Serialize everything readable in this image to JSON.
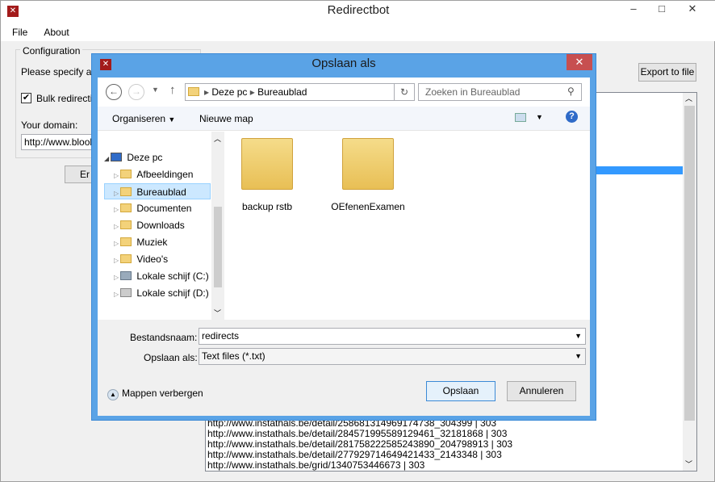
{
  "main": {
    "title": "Redirectbot",
    "menu": [
      "File",
      "About"
    ],
    "group_label": "Configuration",
    "instruction": "Please specify a C",
    "bulk_label": "Bulk redirection",
    "bulk_checked": true,
    "domain_label": "Your domain:",
    "domain_value": "http://www.bloob",
    "action_button": "Er",
    "export_button": "Export to file",
    "output_lines": [
      "http://www.instathals.be/detail/258681314969174738_304399 | 303",
      "http://www.instathals.be/detail/284571995589129461_32181868 | 303",
      "http://www.instathals.be/detail/281758222585243890_204798913 | 303",
      "http://www.instathals.be/detail/277929714649421433_2143348 | 303",
      "http://www.instathals.be/grid/1340753446673 | 303"
    ]
  },
  "dialog": {
    "title": "Opslaan als",
    "breadcrumb": [
      "Deze pc",
      "Bureaublad"
    ],
    "search_placeholder": "Zoeken in Bureaublad",
    "organize": "Organiseren",
    "new_folder": "Nieuwe map",
    "tree": [
      {
        "label": "Deze pc",
        "root": true
      },
      {
        "label": "Afbeeldingen"
      },
      {
        "label": "Bureaublad",
        "selected": true
      },
      {
        "label": "Documenten"
      },
      {
        "label": "Downloads"
      },
      {
        "label": "Muziek"
      },
      {
        "label": "Video's"
      },
      {
        "label": "Lokale schijf (C:)"
      },
      {
        "label": "Lokale schijf (D:)"
      }
    ],
    "files": [
      "backup rstb",
      "OEfenenExamen"
    ],
    "filename_label": "Bestandsnaam:",
    "filename_value": "redirects",
    "type_label": "Opslaan als:",
    "type_value": "Text files (*.txt)",
    "hide_folders": "Mappen verbergen",
    "save": "Opslaan",
    "cancel": "Annuleren",
    "accent": "#5aa3e6"
  }
}
